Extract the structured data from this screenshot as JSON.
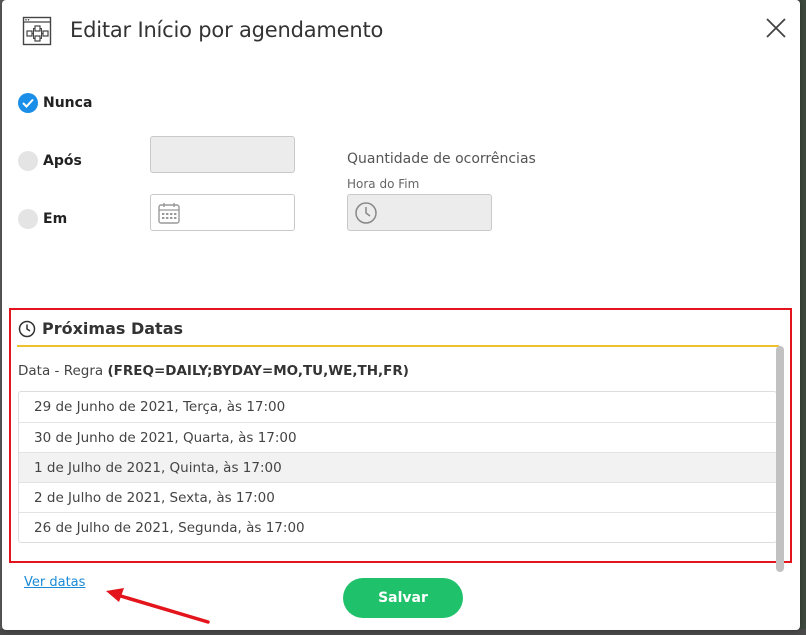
{
  "dialog": {
    "title": "Editar Início por agendamento",
    "header_icon": "workflow-icon",
    "close_icon": "close-icon"
  },
  "end_options": [
    {
      "label": "Nunca",
      "checked": true
    },
    {
      "label": "Após",
      "checked": false
    },
    {
      "label": "Em",
      "checked": false
    }
  ],
  "fields": {
    "occurrences_value": "",
    "occurrences_label": "Quantidade de ocorrências",
    "date_value": "",
    "date_icon": "calendar-icon",
    "end_time_label": "Hora do Fim",
    "end_time_value": "",
    "time_icon": "clock-icon"
  },
  "next_dates": {
    "title": "Próximas Datas",
    "icon": "clock-icon",
    "rule_prefix": "Data - Regra",
    "rule_value": "(FREQ=DAILY;BYDAY=MO,TU,WE,TH,FR)",
    "dates": [
      "29 de Junho de 2021, Terça, às 17:00",
      "30 de Junho de 2021, Quarta, às 17:00",
      "1 de Julho de 2021, Quinta, às 17:00",
      "2 de Julho de 2021, Sexta, às 17:00",
      "26 de Julho de 2021, Segunda, às 17:00"
    ]
  },
  "footer": {
    "link_label": "Ver datas",
    "save_label": "Salvar"
  },
  "colors": {
    "accent_blue": "#1b8ee8",
    "save_green": "#1fc16b",
    "highlight_red": "#e3141c",
    "rule_yellow": "#f0c12c",
    "link_blue": "#1a8ad6"
  }
}
